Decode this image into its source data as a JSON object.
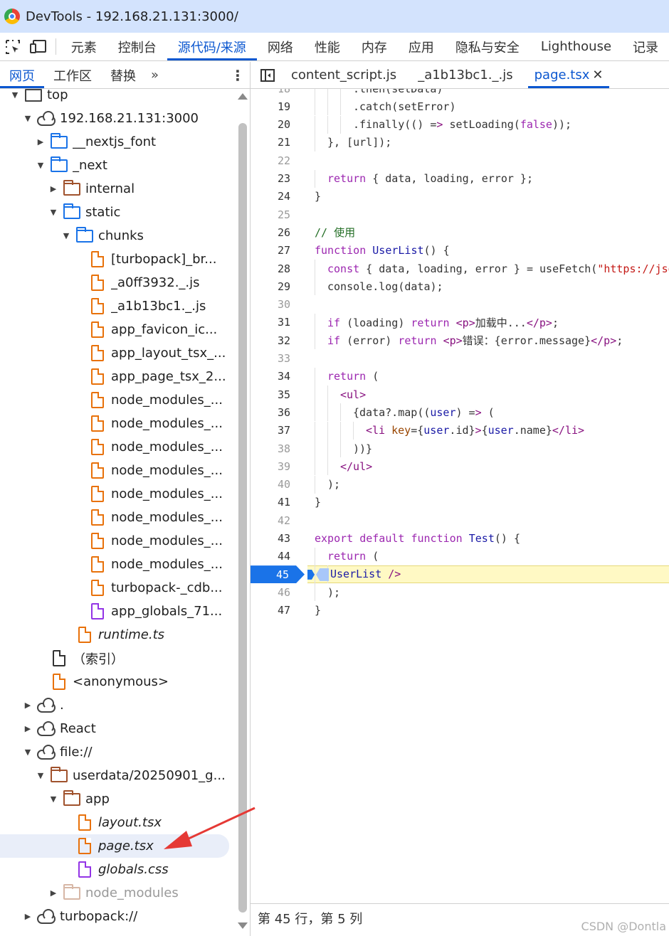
{
  "window": {
    "title": "DevTools - 192.168.21.131:3000/"
  },
  "main_tabs": [
    "元素",
    "控制台",
    "源代码/来源",
    "网络",
    "性能",
    "内存",
    "应用",
    "隐私与安全",
    "Lighthouse",
    "记录"
  ],
  "main_tab_active": "源代码/来源",
  "navigator": {
    "tabs": [
      "网页",
      "工作区",
      "替换"
    ],
    "more": "»",
    "menu": "⋮"
  },
  "tree": [
    {
      "label": "top",
      "icon": "frame",
      "depth": 1,
      "arrow": "down"
    },
    {
      "label": "192.168.21.131:3000",
      "icon": "cloud",
      "depth": 2,
      "arrow": "down"
    },
    {
      "label": "__nextjs_font",
      "icon": "folder-blue",
      "depth": 3,
      "arrow": "right"
    },
    {
      "label": "_next",
      "icon": "folder-blue",
      "depth": 3,
      "arrow": "down"
    },
    {
      "label": "internal",
      "icon": "folder-brown",
      "depth": 4,
      "arrow": "right"
    },
    {
      "label": "static",
      "icon": "folder-blue",
      "depth": 4,
      "arrow": "down"
    },
    {
      "label": "chunks",
      "icon": "folder-blue",
      "depth": 5,
      "arrow": "down"
    },
    {
      "label": "[turbopack]_br...",
      "icon": "file-orange",
      "depth": 6,
      "arrow": ""
    },
    {
      "label": "_a0ff3932._.js",
      "icon": "file-orange",
      "depth": 6,
      "arrow": ""
    },
    {
      "label": "_a1b13bc1._.js",
      "icon": "file-orange",
      "depth": 6,
      "arrow": ""
    },
    {
      "label": "app_favicon_ic...",
      "icon": "file-orange",
      "depth": 6,
      "arrow": ""
    },
    {
      "label": "app_layout_tsx_...",
      "icon": "file-orange",
      "depth": 6,
      "arrow": ""
    },
    {
      "label": "app_page_tsx_2...",
      "icon": "file-orange",
      "depth": 6,
      "arrow": ""
    },
    {
      "label": "node_modules_...",
      "icon": "file-orange",
      "depth": 6,
      "arrow": ""
    },
    {
      "label": "node_modules_...",
      "icon": "file-orange",
      "depth": 6,
      "arrow": ""
    },
    {
      "label": "node_modules_...",
      "icon": "file-orange",
      "depth": 6,
      "arrow": ""
    },
    {
      "label": "node_modules_...",
      "icon": "file-orange",
      "depth": 6,
      "arrow": ""
    },
    {
      "label": "node_modules_...",
      "icon": "file-orange",
      "depth": 6,
      "arrow": ""
    },
    {
      "label": "node_modules_...",
      "icon": "file-orange",
      "depth": 6,
      "arrow": ""
    },
    {
      "label": "node_modules_...",
      "icon": "file-orange",
      "depth": 6,
      "arrow": ""
    },
    {
      "label": "node_modules_...",
      "icon": "file-orange",
      "depth": 6,
      "arrow": ""
    },
    {
      "label": "turbopack-_cdb...",
      "icon": "file-orange",
      "depth": 6,
      "arrow": ""
    },
    {
      "label": "app_globals_71...",
      "icon": "file-purple",
      "depth": 6,
      "arrow": ""
    },
    {
      "label": "runtime.ts",
      "icon": "file-orange",
      "depth": 5,
      "arrow": "",
      "italic": true
    },
    {
      "label": "（索引）",
      "icon": "file-gray",
      "depth": 3,
      "arrow": ""
    },
    {
      "label": "<anonymous>",
      "icon": "file-orange",
      "depth": 3,
      "arrow": ""
    },
    {
      "label": ".",
      "icon": "cloud",
      "depth": 2,
      "arrow": "right"
    },
    {
      "label": "React",
      "icon": "cloud",
      "depth": 2,
      "arrow": "right"
    },
    {
      "label": "file://",
      "icon": "cloud",
      "depth": 2,
      "arrow": "down"
    },
    {
      "label": "userdata/20250901_g...",
      "icon": "folder-brown",
      "depth": 3,
      "arrow": "down"
    },
    {
      "label": "app",
      "icon": "folder-brown",
      "depth": 4,
      "arrow": "down"
    },
    {
      "label": "layout.tsx",
      "icon": "file-orange",
      "depth": 5,
      "arrow": "",
      "italic": true
    },
    {
      "label": "page.tsx",
      "icon": "file-orange",
      "depth": 5,
      "arrow": "",
      "italic": true,
      "selected": true
    },
    {
      "label": "globals.css",
      "icon": "file-purple",
      "depth": 5,
      "arrow": "",
      "italic": true
    },
    {
      "label": "node_modules",
      "icon": "folder-dim",
      "depth": 4,
      "arrow": "right",
      "dim": true
    },
    {
      "label": "turbopack://",
      "icon": "cloud",
      "depth": 2,
      "arrow": "right"
    }
  ],
  "editor": {
    "tabs": [
      "content_script.js",
      "_a1b13bc1._.js",
      "page.tsx"
    ],
    "active_tab": "page.tsx",
    "close": "✕",
    "lines": [
      {
        "n": "18",
        "indent": 3,
        "text": ".then(setData)"
      },
      {
        "n": "19",
        "indent": 3,
        "text": ".catch(setError)"
      },
      {
        "n": "20",
        "indent": 3,
        "text": ".finally(() => setLoading(false));"
      },
      {
        "n": "21",
        "indent": 1,
        "text": "}, [url]);"
      },
      {
        "n": "22",
        "indent": 0,
        "text": ""
      },
      {
        "n": "23",
        "indent": 1,
        "text": "return { data, loading, error };"
      },
      {
        "n": "24",
        "indent": 0,
        "text": "}"
      },
      {
        "n": "25",
        "indent": 0,
        "text": ""
      },
      {
        "n": "26",
        "indent": 0,
        "text": "// 使用"
      },
      {
        "n": "27",
        "indent": 0,
        "text": "function UserList() {"
      },
      {
        "n": "28",
        "indent": 1,
        "text": "const { data, loading, error } = useFetch(\"https://jsonplaceholder"
      },
      {
        "n": "29",
        "indent": 1,
        "text": "console.log(data);"
      },
      {
        "n": "30",
        "indent": 0,
        "text": ""
      },
      {
        "n": "31",
        "indent": 1,
        "text": "if (loading) return <p>加载中...</p>;"
      },
      {
        "n": "32",
        "indent": 1,
        "text": "if (error) return <p>错误：{error.message}</p>;"
      },
      {
        "n": "33",
        "indent": 0,
        "text": ""
      },
      {
        "n": "34",
        "indent": 1,
        "text": "return ("
      },
      {
        "n": "35",
        "indent": 2,
        "text": "<ul>"
      },
      {
        "n": "36",
        "indent": 3,
        "text": "{data?.map((user) => ("
      },
      {
        "n": "37",
        "indent": 4,
        "text": "<li key={user.id}>{user.name}</li>"
      },
      {
        "n": "38",
        "indent": 3,
        "text": "))}"
      },
      {
        "n": "39",
        "indent": 2,
        "text": "</ul>"
      },
      {
        "n": "40",
        "indent": 1,
        "text": ");"
      },
      {
        "n": "41",
        "indent": 0,
        "text": "}"
      },
      {
        "n": "42",
        "indent": 0,
        "text": ""
      },
      {
        "n": "43",
        "indent": 0,
        "text": "export default function Test() {"
      },
      {
        "n": "44",
        "indent": 1,
        "text": "return ("
      },
      {
        "n": "45",
        "indent": 2,
        "text": "<UserList />",
        "breakpoint": true
      },
      {
        "n": "46",
        "indent": 1,
        "text": ");"
      },
      {
        "n": "47",
        "indent": 0,
        "text": "}"
      }
    ]
  },
  "status": {
    "position": "第 45 行，第 5 列"
  },
  "watermark": "CSDN @Dontla",
  "colors": {
    "accent": "#0b57d0",
    "breakpoint": "#1a73e8",
    "exec_line": "#fff9c4",
    "arrow": "#e53935"
  }
}
